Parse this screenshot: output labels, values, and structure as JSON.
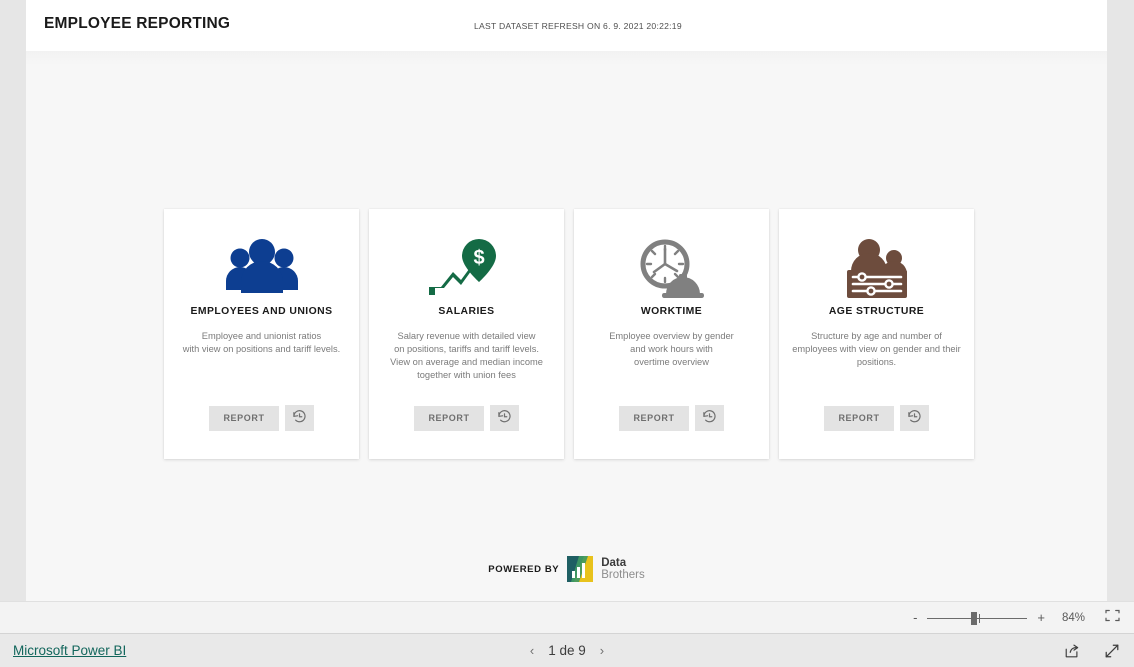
{
  "report": {
    "title": "EMPLOYEE REPORTING",
    "refresh_text": "LAST DATASET REFRESH ON 6. 9. 2021 20:22:19"
  },
  "cards": [
    {
      "icon": "people-group-icon",
      "title": "EMPLOYEES AND UNIONS",
      "description": "Employee and unionist ratios\nwith view on positions and tariff levels.",
      "report_label": "REPORT",
      "history_icon": "history-clock-icon",
      "color": "#0d3e91"
    },
    {
      "icon": "money-pin-growth-icon",
      "title": "SALARIES",
      "description": "Salary revenue with detailed view\non positions, tariffs and tariff levels.\nView on average and median income\ntogether with union fees",
      "report_label": "REPORT",
      "history_icon": "history-clock-icon",
      "color": "#146b45"
    },
    {
      "icon": "clock-hardhat-icon",
      "title": "WORKTIME",
      "description": "Employee overview by gender\nand work hours with\novertime overview",
      "report_label": "REPORT",
      "history_icon": "history-clock-icon",
      "color": "#808080"
    },
    {
      "icon": "people-controls-icon",
      "title": "AGE STRUCTURE",
      "description": "Structure by age and number of\nemployees with view on gender and their\npositions.",
      "report_label": "REPORT",
      "history_icon": "history-clock-icon",
      "color": "#6d4c3d"
    }
  ],
  "powered_by": {
    "label": "POWERED BY",
    "brand_line1": "Data",
    "brand_line2": "Brothers",
    "logo_icon": "bar-chart-logo-icon"
  },
  "zoombar": {
    "minus_label": "-",
    "plus_label": "+",
    "zoom_level": "84%",
    "fit_icon": "fit-to-page-icon"
  },
  "bottombar": {
    "powerbi_link": "Microsoft Power BI",
    "prev_icon": "chevron-left-icon",
    "page_text": "1 de 9",
    "next_icon": "chevron-right-icon",
    "share_icon": "share-icon",
    "fullscreen_icon": "fullscreen-icon"
  }
}
